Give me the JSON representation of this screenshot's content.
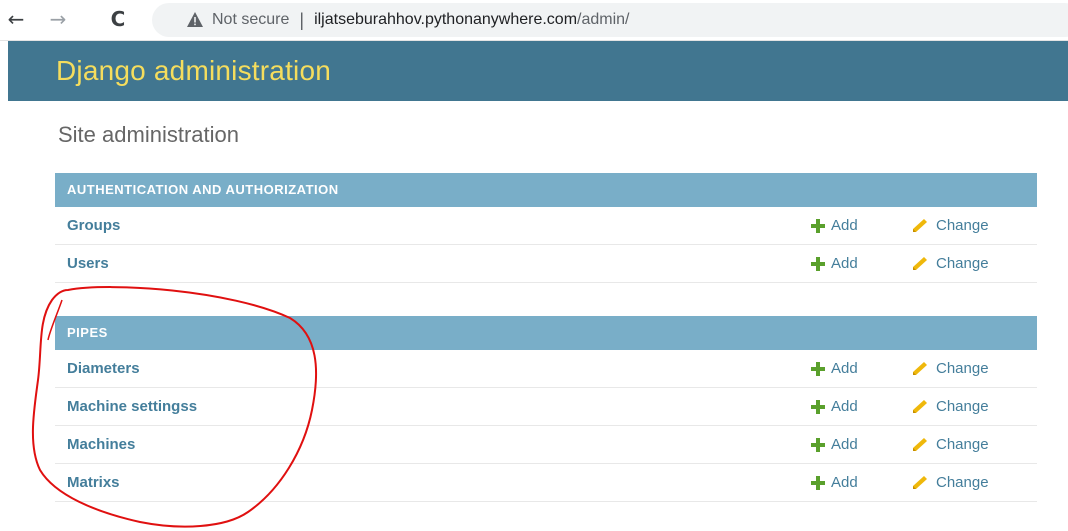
{
  "browser": {
    "back_icon": "←",
    "forward_icon": "→",
    "reload_icon": "C",
    "security_label": "Not secure",
    "separator": "|",
    "url_host": "iljatseburahhov.pythonanywhere.com",
    "url_path": "/admin/"
  },
  "header": {
    "brand": "Django administration",
    "header_color": "#417690",
    "brand_color": "#f5dd5d"
  },
  "page": {
    "title": "Site administration"
  },
  "modules": [
    {
      "caption": "AUTHENTICATION AND AUTHORIZATION",
      "rows": [
        {
          "name": "Groups",
          "add": "Add",
          "change": "Change"
        },
        {
          "name": "Users",
          "add": "Add",
          "change": "Change"
        }
      ]
    },
    {
      "caption": "PIPES",
      "rows": [
        {
          "name": "Diameters",
          "add": "Add",
          "change": "Change"
        },
        {
          "name": "Machine settingss",
          "add": "Add",
          "change": "Change"
        },
        {
          "name": "Machines",
          "add": "Add",
          "change": "Change"
        },
        {
          "name": "Matrixs",
          "add": "Add",
          "change": "Change"
        }
      ]
    }
  ],
  "colors": {
    "caption_bg": "#79aec8",
    "link": "#447e9b",
    "add_icon": "#5aa02c",
    "change_icon": "#efb80b",
    "annotation": "#e01010"
  },
  "icons": {
    "add": "plus-icon",
    "change": "pencil-icon",
    "security": "warning-triangle-icon"
  }
}
